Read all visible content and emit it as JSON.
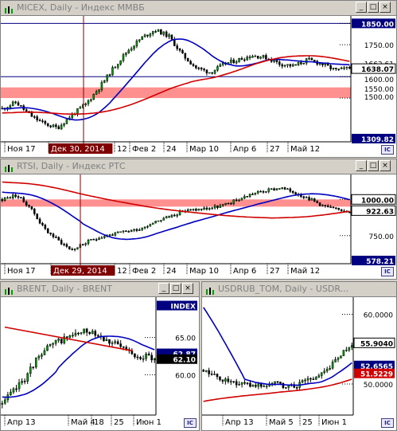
{
  "windows": [
    {
      "id": "micex",
      "title": "MICEX, Daily - Индекс ММВБ",
      "ohlc_icon": "chart-icon",
      "price_labels": [
        "1850.00",
        "1750.00",
        "1662.61",
        "1638.07",
        "1600.00",
        "1550.00",
        "1500.00",
        "1309.82"
      ],
      "x_labels": [
        "Ноя 17",
        "Дек 30, 2014",
        "12",
        "Фев 2",
        "24",
        "Мар 10",
        "Апр 6",
        "27",
        "Май 12"
      ],
      "cursor_label": "Дек 30, 2014"
    },
    {
      "id": "rtsi",
      "title": "RTSI, Daily - Индекс РТС",
      "price_labels": [
        "1000.00",
        "922.63",
        "750.00",
        "578.21"
      ],
      "x_labels": [
        "Ноя 17",
        "Дек 29, 2014",
        "12",
        "Фев 2",
        "24",
        "Мар 10",
        "Апр 6",
        "27",
        "Май 12"
      ],
      "cursor_label": "Дек 29, 2014"
    },
    {
      "id": "brent",
      "title": "BRENT, Daily - BRENT",
      "price_labels": [
        "INDEX",
        "65.00",
        "62.87",
        "62.10",
        "60.00"
      ],
      "x_labels": [
        "Апр 13",
        "Май 4",
        "18",
        "25",
        "Июн 1"
      ]
    },
    {
      "id": "usdrub",
      "title": "USDRUB_TOM, Daily - USDR...",
      "price_labels": [
        "60.0000",
        "55.9040",
        "52.6565",
        "51.5229",
        "50.0000"
      ],
      "x_labels": [
        "Апр 13",
        "Май 5",
        "25",
        "Июн 1"
      ]
    }
  ],
  "window_buttons": [
    "_",
    "□",
    "×"
  ],
  "corner_button": "IC",
  "colors": {
    "bull": "#00a000",
    "bear": "#000000",
    "ma_fast": "#0000c0",
    "ma_slow": "#d00000",
    "zone": "#ff9090",
    "title_bar": "#d4d0c8",
    "price_box": "#000080",
    "price_box_red": "#d00000"
  },
  "chart_data": [
    {
      "type": "candlestick",
      "name": "MICEX",
      "ylim": [
        1309.82,
        1870
      ],
      "y_ticks": [
        1850,
        1750,
        1600,
        1500
      ],
      "horizontal_levels": [
        1850,
        1600
      ],
      "zone": [
        1500,
        1550
      ],
      "last_price": 1638.07,
      "ma_fast_last": 1662.61,
      "ma_slow_last": 1600
    },
    {
      "type": "candlestick",
      "name": "RTSI",
      "ylim": [
        578.21,
        1150
      ],
      "y_ticks": [
        1000,
        750
      ],
      "zone": [
        950,
        1000
      ],
      "last_price": 922.63
    },
    {
      "type": "candlestick",
      "name": "BRENT",
      "ylim": [
        55,
        70
      ],
      "y_ticks": [
        65,
        60
      ],
      "last_price": 62.1,
      "ma_last": 62.87
    },
    {
      "type": "candlestick",
      "name": "USDRUB_TOM",
      "ylim": [
        46,
        62
      ],
      "y_ticks": [
        60,
        50
      ],
      "last_price": 55.904,
      "ma_fast_last": 52.6565,
      "ma_slow_last": 51.5229
    }
  ]
}
